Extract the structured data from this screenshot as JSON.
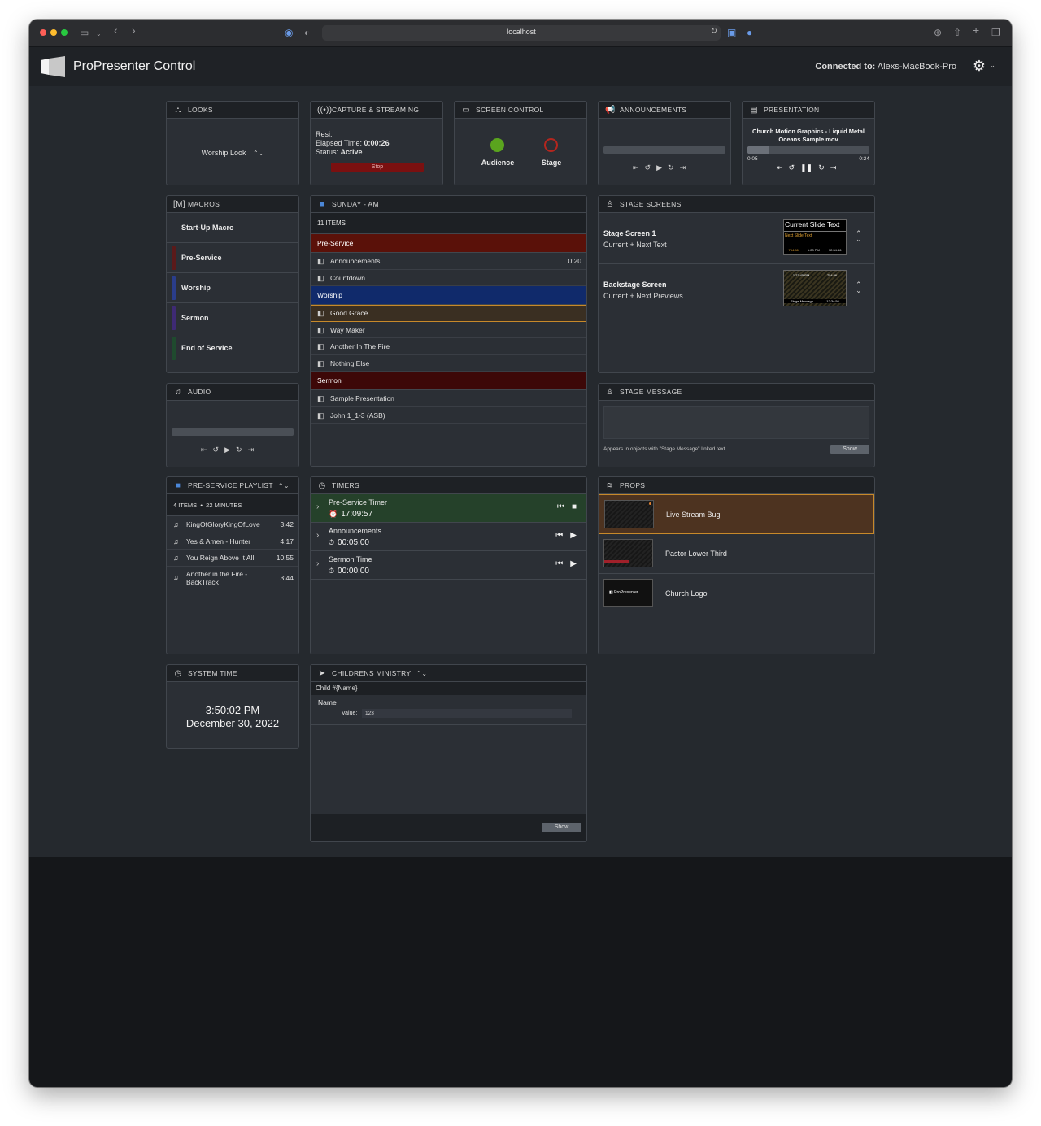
{
  "browser": {
    "url": "localhost"
  },
  "app": {
    "title": "ProPresenter Control",
    "connected_label": "Connected to:",
    "connected_host": "Alexs-MacBook-Pro"
  },
  "looks": {
    "title": "LOOKS",
    "current": "Worship Look"
  },
  "capture": {
    "title": "CAPTURE & STREAMING",
    "resi": "Resi:",
    "elapsed_label": "Elapsed Time:",
    "elapsed": "0:00:26",
    "status_label": "Status:",
    "status": "Active",
    "stop": "Stop"
  },
  "screen_control": {
    "title": "SCREEN CONTROL",
    "audience": "Audience",
    "stage": "Stage",
    "audience_color": "#5aa41e",
    "stage_color": "#b3261e"
  },
  "announcements": {
    "title": "ANNOUNCEMENTS"
  },
  "presentation": {
    "title": "PRESENTATION",
    "media": "Church Motion Graphics - Liquid Metal Oceans Sample.mov",
    "elapsed": "0:05",
    "remaining": "-0:24",
    "progress": 0.17
  },
  "macros": {
    "title": "MACROS",
    "items": [
      {
        "label": "Start-Up Macro",
        "color": ""
      },
      {
        "label": "Pre-Service",
        "color": "#5b1a1a"
      },
      {
        "label": "Worship",
        "color": "#2a3d8a"
      },
      {
        "label": "Sermon",
        "color": "#3e2a74"
      },
      {
        "label": "End of Service",
        "color": "#1f4a2e"
      }
    ]
  },
  "playlist": {
    "title": "SUNDAY - AM",
    "count": "11 ITEMS",
    "sections": {
      "pre_service": "Pre-Service",
      "worship": "Worship",
      "sermon": "Sermon"
    },
    "items": {
      "announcements": "Announcements",
      "announcements_duration": "0:20",
      "countdown": "Countdown",
      "good_grace": "Good Grace",
      "way_maker": "Way Maker",
      "another_in_the_fire": "Another In The Fire",
      "nothing_else": "Nothing Else",
      "sample_presentation": "Sample Presentation",
      "john": "John 1_1-3 (ASB)"
    },
    "colors": {
      "pre_service": "#5a1109",
      "worship": "#102a6b",
      "sermon": "#3d0808",
      "selected_border": "#c7892a"
    }
  },
  "stage_screens": {
    "title": "STAGE SCREENS",
    "items": [
      {
        "name": "Stage Screen 1",
        "layout": "Current + Next Text",
        "preview_current": "Current Slide Text",
        "preview_next": "Next Slide Text",
        "preview_times": [
          "754:56",
          "1:23 PM",
          "12:34:56"
        ]
      },
      {
        "name": "Backstage Screen",
        "layout": "Current + Next Previews",
        "preview_times": [
          "1:23:45 PM",
          "754:56"
        ],
        "preview_message": "Stage Message",
        "preview_clock": "12:34:56"
      }
    ]
  },
  "audio": {
    "title": "AUDIO"
  },
  "stage_message": {
    "title": "STAGE MESSAGE",
    "hint": "Appears in objects with \"Stage Message\" linked text.",
    "show": "Show"
  },
  "pre_service_playlist": {
    "title": "PRE-SERVICE PLAYLIST",
    "count": "4 ITEMS",
    "separator": "•",
    "duration": "22 MINUTES",
    "items": [
      {
        "name": "KingOfGloryKingOfLove",
        "duration": "3:42"
      },
      {
        "name": "Yes & Amen - Hunter",
        "duration": "4:17"
      },
      {
        "name": "You Reign Above It All",
        "duration": "10:55"
      },
      {
        "name": "Another in the Fire - BackTrack",
        "duration": "3:44"
      }
    ]
  },
  "timers": {
    "title": "TIMERS",
    "items": [
      {
        "name": "Pre-Service Timer",
        "value": "17:09:57",
        "running": true
      },
      {
        "name": "Announcements",
        "value": "00:05:00",
        "running": false
      },
      {
        "name": "Sermon Time",
        "value": "00:00:00",
        "running": false
      }
    ]
  },
  "props": {
    "title": "PROPS",
    "items": [
      {
        "name": "Live Stream Bug"
      },
      {
        "name": "Pastor Lower Third"
      },
      {
        "name": "Church Logo",
        "thumb_text": "ProPresenter"
      }
    ],
    "selected_color": "#4d3320"
  },
  "system_time": {
    "title": "SYSTEM TIME",
    "time": "3:50:02 PM",
    "date": "December 30, 2022"
  },
  "childrens_ministry": {
    "title": "CHILDRENS MINISTRY",
    "template": "Child #{Name}",
    "field_name": "Name",
    "value_label": "Value:",
    "value": "123",
    "show": "Show"
  }
}
